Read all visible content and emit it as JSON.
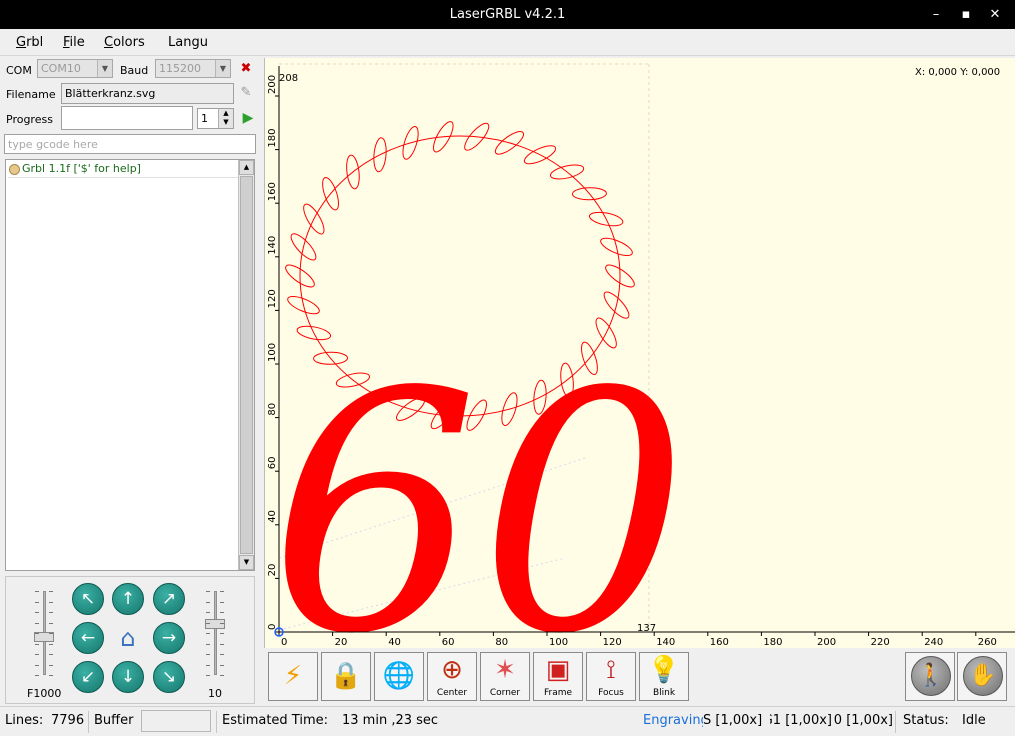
{
  "window": {
    "title": "LaserGRBL v4.2.1",
    "minimize_glyph": "–",
    "maximize_glyph": "▪",
    "close_glyph": "✕"
  },
  "menu": [
    {
      "label": "Grbl",
      "accel": "G",
      "rest": "rbl"
    },
    {
      "label": "File",
      "accel": "F",
      "rest": "ile"
    },
    {
      "label": "Colors",
      "accel": "C",
      "rest": "olors"
    },
    {
      "label": "Langu",
      "accel": "",
      "rest": "Langu"
    }
  ],
  "connection": {
    "com_label": "COM",
    "com_value": "COM10",
    "baud_label": "Baud",
    "baud_value": "115200",
    "filename_label": "Filename",
    "filename_value": "Blätterkranz.svg",
    "progress_label": "Progress",
    "progress_value": "",
    "copies_value": "1",
    "gcode_placeholder": "type gcode here"
  },
  "console": {
    "lines": [
      "Grbl 1.1f ['$' for help]"
    ]
  },
  "jog": {
    "speed_label": "F1000",
    "step_label": "10",
    "speed_level": 0.55,
    "step_level": 0.38
  },
  "canvas": {
    "coord_readout": "X: 0,000 Y: 0,000",
    "x_ticks": [
      "0",
      "20",
      "40",
      "60",
      "80",
      "100",
      "120",
      "140",
      "160",
      "180",
      "200",
      "220",
      "240",
      "260"
    ],
    "y_ticks": [
      "0",
      "20",
      "40",
      "60",
      "80",
      "100",
      "120",
      "140",
      "160",
      "180",
      "200"
    ],
    "x_max_label": "137",
    "y_max_label": "208",
    "design_text": "60",
    "colors": {
      "background": "#fffde6",
      "stroke": "#ff0000",
      "axis": "#000000"
    }
  },
  "toolbar": {
    "buttons": [
      {
        "name": "engrave-button",
        "label": "",
        "icon": "lightning-icon",
        "glyph": "⚡",
        "color": "#f0a000"
      },
      {
        "name": "unlock-button",
        "label": "",
        "icon": "padlock-icon",
        "glyph": "🔒",
        "color": "#d0a020"
      },
      {
        "name": "globe-button",
        "label": "",
        "icon": "globe-icon",
        "glyph": "🌐",
        "color": "#808080"
      },
      {
        "name": "center-button",
        "label": "Center",
        "icon": "crosshair-icon",
        "glyph": "⊕",
        "color": "#c03010"
      },
      {
        "name": "corner-button",
        "label": "Corner",
        "icon": "corner-icon",
        "glyph": "✶",
        "color": "#e05050"
      },
      {
        "name": "frame-button",
        "label": "Frame",
        "icon": "frame-icon",
        "glyph": "▣",
        "color": "#d02020"
      },
      {
        "name": "focus-button",
        "label": "Focus",
        "icon": "laser-focus-icon",
        "glyph": "⟟",
        "color": "#c02020"
      },
      {
        "name": "blink-button",
        "label": "Blink",
        "icon": "lightbulb-icon",
        "glyph": "💡",
        "color": "#e0b020"
      }
    ],
    "walk_glyph": "🚶",
    "stop_glyph": "✋"
  },
  "status": {
    "lines_label": "Lines:",
    "lines_value": "7796",
    "buffer_label": "Buffer",
    "estimated_label": "Estimated Time:",
    "estimated_value": "13 min ,23 sec",
    "mode": "Engraving",
    "override_1": "S [1,00x]",
    "override_2": "G1 [1,00x]",
    "override_3": "G0 [1,00x]",
    "status_label": "Status:",
    "status_value": "Idle",
    "mode_color": "#1a6fd8"
  }
}
